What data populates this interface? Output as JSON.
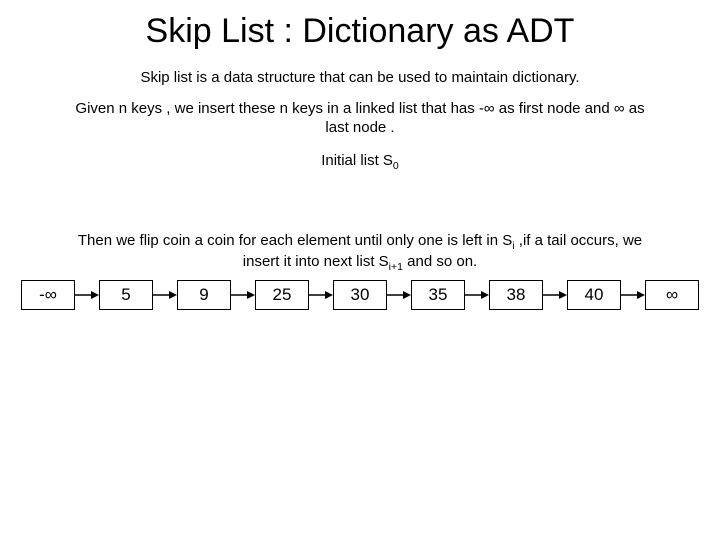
{
  "title": "Skip List : Dictionary as ADT",
  "subtitle": "Skip list is a data structure that can be used to maintain dictionary.",
  "para1_a": "Given n keys , we insert these n keys in a linked list that has -∞ as first node and ∞ as",
  "para1_b": "last node .",
  "initlist_a": "Initial list S",
  "initlist_sub": "0",
  "flip_a": "Then we flip coin a coin for each element until only one is left in S",
  "flip_sub1": "i",
  "flip_b": " ,if a tail occurs, we",
  "flip_c": "insert it into next list S",
  "flip_sub2": "i+1",
  "flip_d": " and so on.",
  "nodes": [
    "-∞",
    "5",
    "9",
    "25",
    "30",
    "35",
    "38",
    "40",
    "∞"
  ]
}
